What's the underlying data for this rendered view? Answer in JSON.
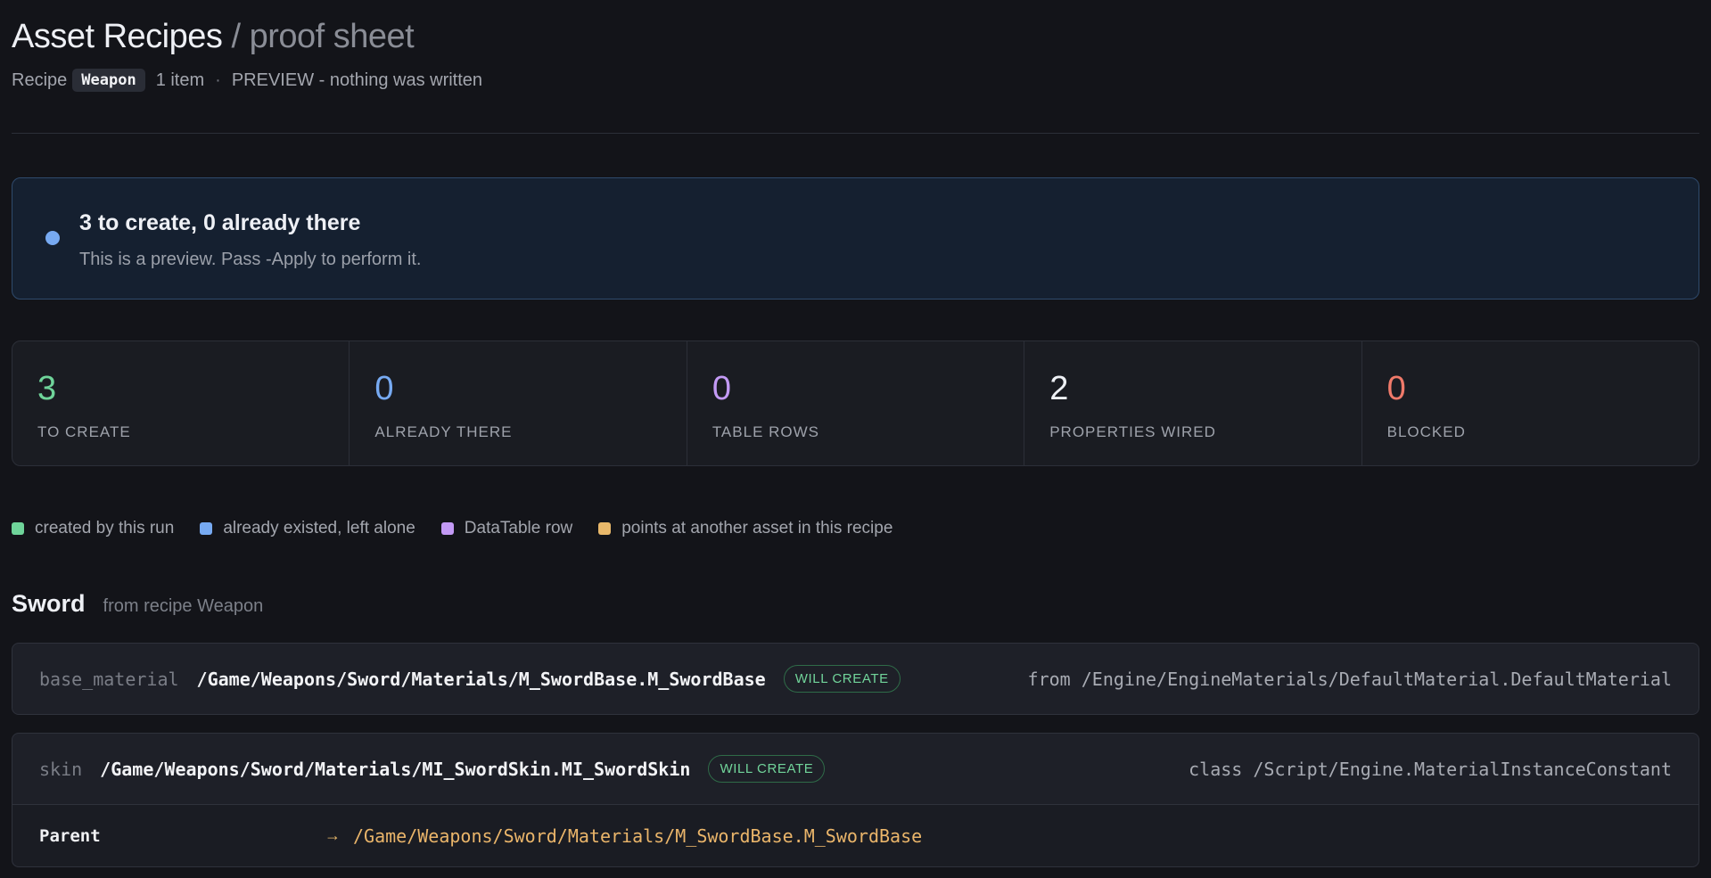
{
  "header": {
    "title": "Asset Recipes",
    "subtitle": "/ proof sheet",
    "recipe_label": "Recipe",
    "recipe_name": "Weapon",
    "item_count": "1 item",
    "separator": "·",
    "mode": "PREVIEW - nothing was written"
  },
  "banner": {
    "heading": "3 to create, 0 already there",
    "message": "This is a preview. Pass -Apply to perform it.",
    "dot_color": "#77aaf2"
  },
  "stats": [
    {
      "value": "3",
      "label": "TO CREATE",
      "color": "#6fd49a"
    },
    {
      "value": "0",
      "label": "ALREADY THERE",
      "color": "#77aaf2"
    },
    {
      "value": "0",
      "label": "TABLE ROWS",
      "color": "#c39af5"
    },
    {
      "value": "2",
      "label": "PROPERTIES WIRED",
      "color": "#eef0f5"
    },
    {
      "value": "0",
      "label": "BLOCKED",
      "color": "#f07a6a"
    }
  ],
  "legend": [
    {
      "label": "created by this run",
      "color": "#6fd49a"
    },
    {
      "label": "already existed, left alone",
      "color": "#77aaf2"
    },
    {
      "label": "DataTable row",
      "color": "#c39af5"
    },
    {
      "label": "points at another asset in this recipe",
      "color": "#e8b86a"
    }
  ],
  "section": {
    "name": "Sword",
    "from": "from recipe Weapon"
  },
  "assets": [
    {
      "key": "base_material",
      "path": "/Game/Weapons/Sword/Materials/M_SwordBase.M_SwordBase",
      "badge": "WILL CREATE",
      "detail": "from /Engine/EngineMaterials/DefaultMaterial.DefaultMaterial"
    },
    {
      "key": "skin",
      "path": "/Game/Weapons/Sword/Materials/MI_SwordSkin.MI_SwordSkin",
      "badge": "WILL CREATE",
      "detail": "class /Script/Engine.MaterialInstanceConstant",
      "property": {
        "label": "Parent",
        "arrow": "→",
        "value": "/Game/Weapons/Sword/Materials/M_SwordBase.M_SwordBase"
      }
    }
  ]
}
